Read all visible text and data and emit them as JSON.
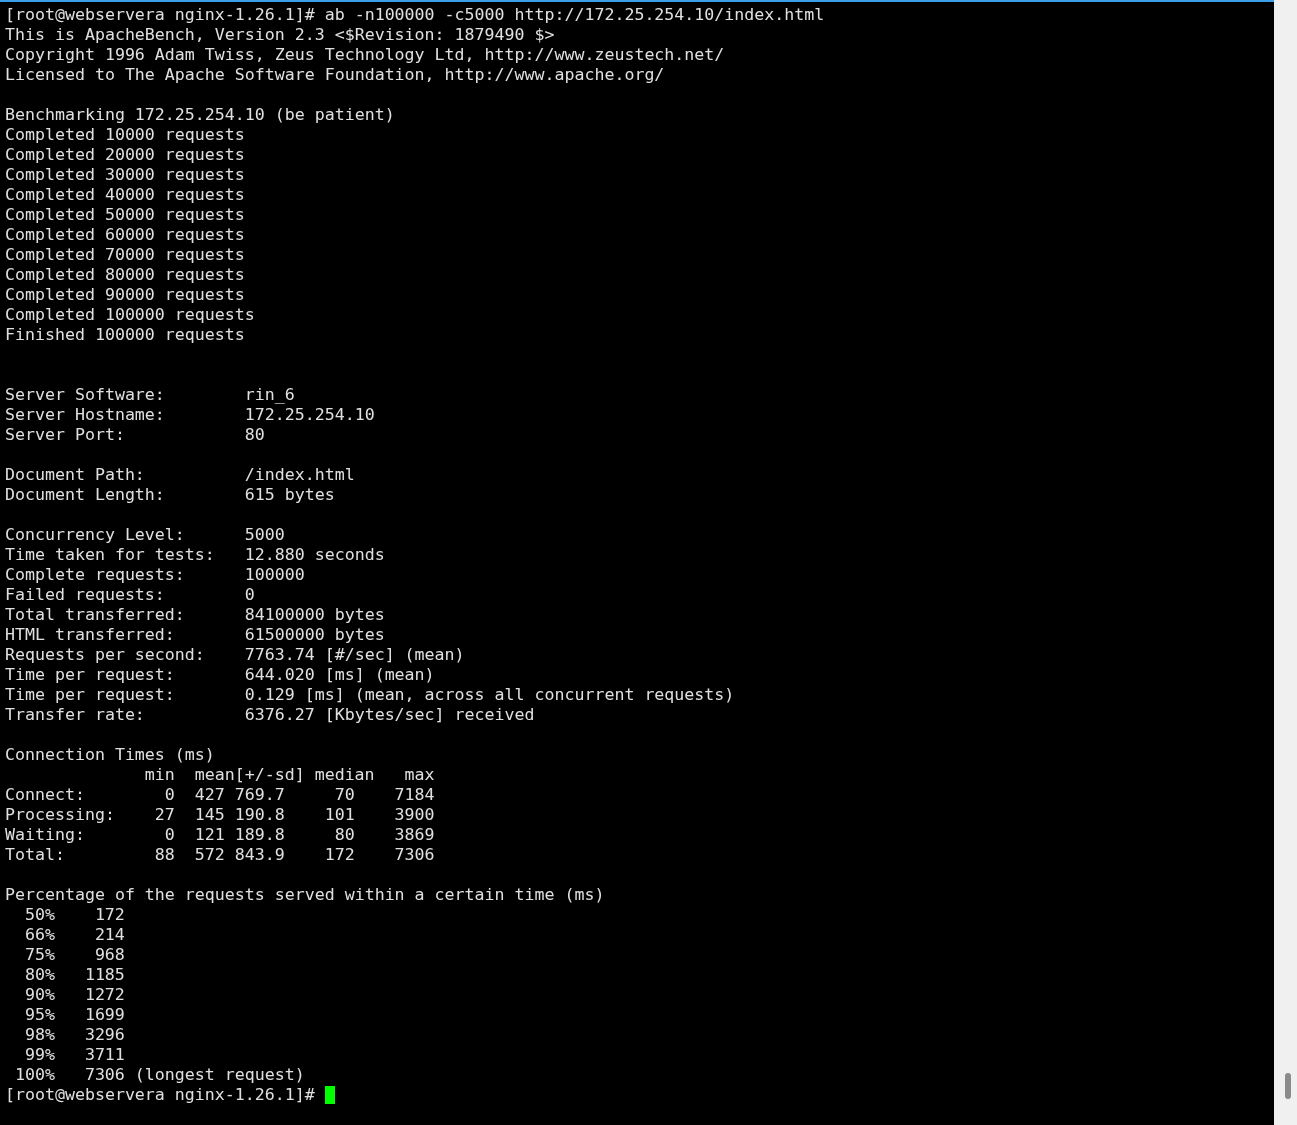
{
  "command_line": {
    "prompt": "[root@webservera nginx-1.26.1]#",
    "command": "ab -n100000 -c5000 http://172.25.254.10/index.html"
  },
  "banner": [
    "This is ApacheBench, Version 2.3 <$Revision: 1879490 $>",
    "Copyright 1996 Adam Twiss, Zeus Technology Ltd, http://www.zeustech.net/",
    "Licensed to The Apache Software Foundation, http://www.apache.org/"
  ],
  "progress": [
    "Benchmarking 172.25.254.10 (be patient)",
    "Completed 10000 requests",
    "Completed 20000 requests",
    "Completed 30000 requests",
    "Completed 40000 requests",
    "Completed 50000 requests",
    "Completed 60000 requests",
    "Completed 70000 requests",
    "Completed 80000 requests",
    "Completed 90000 requests",
    "Completed 100000 requests",
    "Finished 100000 requests"
  ],
  "results": [
    [
      {
        "label": "Server Software:",
        "value": "rin_6"
      },
      {
        "label": "Server Hostname:",
        "value": "172.25.254.10"
      },
      {
        "label": "Server Port:",
        "value": "80"
      }
    ],
    [
      {
        "label": "Document Path:",
        "value": "/index.html"
      },
      {
        "label": "Document Length:",
        "value": "615 bytes"
      }
    ],
    [
      {
        "label": "Concurrency Level:",
        "value": "5000"
      },
      {
        "label": "Time taken for tests:",
        "value": "12.880 seconds"
      },
      {
        "label": "Complete requests:",
        "value": "100000"
      },
      {
        "label": "Failed requests:",
        "value": "0"
      },
      {
        "label": "Total transferred:",
        "value": "84100000 bytes"
      },
      {
        "label": "HTML transferred:",
        "value": "61500000 bytes"
      },
      {
        "label": "Requests per second:",
        "value": "7763.74 [#/sec] (mean)"
      },
      {
        "label": "Time per request:",
        "value": "644.020 [ms] (mean)"
      },
      {
        "label": "Time per request:",
        "value": "0.129 [ms] (mean, across all concurrent requests)"
      },
      {
        "label": "Transfer rate:",
        "value": "6376.27 [Kbytes/sec] received"
      }
    ]
  ],
  "connection_times": {
    "title": "Connection Times (ms)",
    "columns": [
      "min",
      "mean[+/-sd]",
      "median",
      "max"
    ],
    "rows": [
      {
        "label": "Connect:",
        "cells": [
          "0",
          "427 769.7",
          "70",
          "7184"
        ]
      },
      {
        "label": "Processing:",
        "cells": [
          "27",
          "145 190.8",
          "101",
          "3900"
        ]
      },
      {
        "label": "Waiting:",
        "cells": [
          "0",
          "121 189.8",
          "80",
          "3869"
        ]
      },
      {
        "label": "Total:",
        "cells": [
          "88",
          "572 843.9",
          "172",
          "7306"
        ]
      }
    ]
  },
  "percentiles": {
    "title": "Percentage of the requests served within a certain time (ms)",
    "rows": [
      {
        "percent": "50%",
        "ms": "172"
      },
      {
        "percent": "66%",
        "ms": "214"
      },
      {
        "percent": "75%",
        "ms": "968"
      },
      {
        "percent": "80%",
        "ms": "1185"
      },
      {
        "percent": "90%",
        "ms": "1272"
      },
      {
        "percent": "95%",
        "ms": "1699"
      },
      {
        "percent": "98%",
        "ms": "3296"
      },
      {
        "percent": "99%",
        "ms": "3711"
      },
      {
        "percent": "100%",
        "ms": "7306",
        "note": "(longest request)"
      }
    ]
  },
  "prompt": {
    "prompt": "[root@webservera nginx-1.26.1]#",
    "cursor": true
  }
}
